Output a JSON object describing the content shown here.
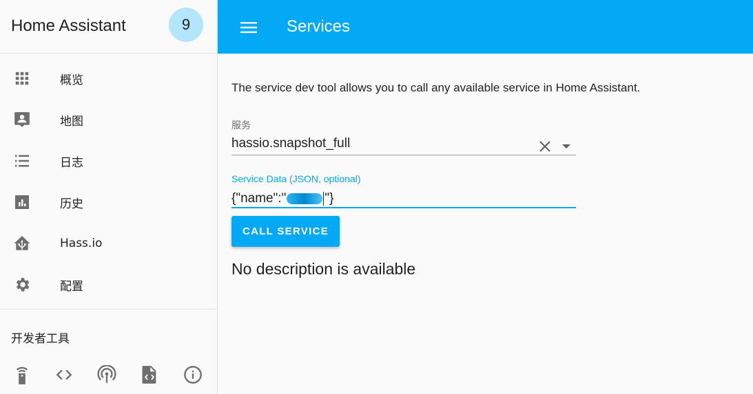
{
  "sidebar": {
    "title": "Home Assistant",
    "notification_count": "9",
    "items": [
      {
        "label": "概览",
        "icon": "apps-grid-icon"
      },
      {
        "label": "地图",
        "icon": "account-box-icon"
      },
      {
        "label": "日志",
        "icon": "format-list-bulleted-icon"
      },
      {
        "label": "历史",
        "icon": "poll-box-icon"
      },
      {
        "label": "Hass.io",
        "icon": "home-assistant-icon"
      },
      {
        "label": "配置",
        "icon": "settings-gear-icon"
      }
    ],
    "dev_tools_title": "开发者工具",
    "dev_tools": [
      "remote-icon",
      "code-tags-icon",
      "radio-tower-icon",
      "file-xml-icon",
      "information-outline-icon"
    ]
  },
  "toolbar": {
    "title": "Services",
    "menu_icon": "menu-icon"
  },
  "main": {
    "intro": "The service dev tool allows you to call any available service in Home Assistant.",
    "service_label": "服务",
    "service_value": "hassio.snapshot_full",
    "data_label": "Service Data (JSON, optional)",
    "data_prefix": "{\"name\":\"",
    "data_suffix": "\"}",
    "call_button": "CALL SERVICE",
    "no_description": "No description is available"
  },
  "colors": {
    "primary": "#03a9f4",
    "badge": "#b3e5fc",
    "icon": "#6e6e6e"
  }
}
